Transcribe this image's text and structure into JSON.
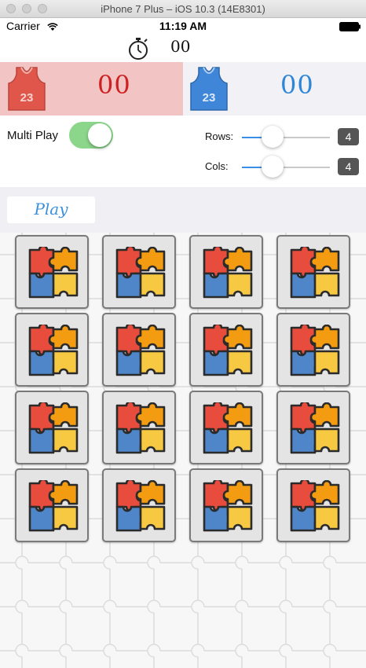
{
  "window": {
    "title": "iPhone 7 Plus – iOS 10.3 (14E8301)"
  },
  "status_bar": {
    "carrier": "Carrier",
    "time": "11:19 AM"
  },
  "timer": {
    "value": "00",
    "icon": "stopwatch-icon"
  },
  "players": [
    {
      "jersey_number": "23",
      "score": "00",
      "color": "#e0564b",
      "score_color": "#cc2222"
    },
    {
      "jersey_number": "23",
      "score": "00",
      "color": "#3f86d8",
      "score_color": "#2f85d8"
    }
  ],
  "controls": {
    "multi_play_label": "Multi Play",
    "multi_play_on": true,
    "rows_label": "Rows:",
    "rows_value": "4",
    "cols_label": "Cols:",
    "cols_value": "4",
    "rows_slider_fraction": 0.3,
    "cols_slider_fraction": 0.3
  },
  "play_button": {
    "label": "Play"
  },
  "board": {
    "rows": 4,
    "cols": 4,
    "tile_icon": "puzzle-pieces-icon"
  }
}
